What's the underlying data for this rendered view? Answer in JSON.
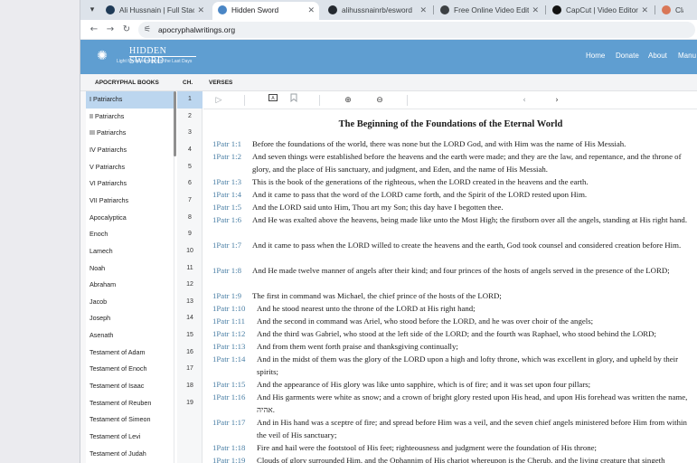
{
  "browser": {
    "tabs": [
      {
        "title": "Ali Hussnain | Full Stack",
        "active": false,
        "favicon_color": "#1f3b57"
      },
      {
        "title": "Hidden Sword",
        "active": true,
        "favicon_color": "#4a86c5"
      },
      {
        "title": "alihussnainrb/esword",
        "active": false,
        "favicon_color": "#24292f"
      },
      {
        "title": "Free Online Video Editor",
        "active": false,
        "favicon_color": "#3c4043"
      },
      {
        "title": "CapCut | Video Editor | A",
        "active": false,
        "favicon_color": "#111111"
      },
      {
        "title": "Claude",
        "active": false,
        "favicon_color": "#d97757"
      }
    ],
    "url": "apocryphalwritings.org"
  },
  "site": {
    "logo_title": "HIDDEN SWORD",
    "logo_subtitle": "Light for the remnant in the Last Days",
    "nav": [
      "Home",
      "Donate",
      "About",
      "Manu"
    ]
  },
  "columns": {
    "books": "APOCRYPHAL BOOKS",
    "chapter": "CH.",
    "verses": "VERSES"
  },
  "books": [
    "I Patriarchs",
    "II Patriarchs",
    "III Patriarchs",
    "IV Patriarchs",
    "V Patriarchs",
    "VI Patriarchs",
    "VII Patriarchs",
    "Apocalyptica",
    "Enoch",
    "Lamech",
    "Noah",
    "Abraham",
    "Jacob",
    "Joseph",
    "Asenath",
    "Testament of Adam",
    "Testament of Enoch",
    "Testament of Isaac",
    "Testament of Reuben",
    "Testament of Simeon",
    "Testament of Levi",
    "Testament of Judah"
  ],
  "selected_book": 0,
  "chapters": [
    "1",
    "2",
    "3",
    "4",
    "5",
    "6",
    "7",
    "8",
    "9",
    "10",
    "11",
    "12",
    "13",
    "14",
    "15",
    "16",
    "17",
    "18",
    "19"
  ],
  "selected_chapter": 0,
  "verse_title": "The Beginning of the Foundations of the Eternal World",
  "verses": [
    {
      "ref": "1Patr 1:1",
      "text": "Before the foundations of the world, there was none but the LORD God, and with Him was the name of His Messiah.",
      "lines": 1
    },
    {
      "ref": "1Patr 1:2",
      "text": "And seven things were established before the heavens and the earth were made; and they are the law, and repentance, and the throne of glory, and the place of His sanctuary, and judgment, and Eden, and the name of His Messiah.",
      "lines": 2
    },
    {
      "ref": "1Patr 1:3",
      "text": "This is the book of the generations of the righteous, when the LORD created in the heavens and the earth.",
      "lines": 1
    },
    {
      "ref": "1Patr 1:4",
      "text": "And it came to pass that the word of the LORD came forth, and the Spirit of the LORD rested upon Him.",
      "lines": 1
    },
    {
      "ref": "1Patr 1:5",
      "text": "And the LORD said unto Him, Thou art my Son; this day have I begotten thee.",
      "lines": 1
    },
    {
      "ref": "1Patr 1:6",
      "text": "And He was exalted above the heavens, being made like unto the Most High; the firstborn over all the angels, standing at His right hand.",
      "lines": 2
    },
    {
      "ref": "1Patr 1:7",
      "text": "And it came to pass when the LORD willed to create the heavens and the earth, God took counsel and considered creation before Him.",
      "lines": 2
    },
    {
      "ref": "1Patr 1:8",
      "text": "And He made twelve manner of angels after their kind; and four princes of the hosts of angels served in the presence of the LORD;",
      "lines": 2
    },
    {
      "ref": "1Patr 1:9",
      "text": "The first in command was Michael, the chief prince of the hosts of the LORD;",
      "lines": 1
    },
    {
      "ref": "1Patr 1:10",
      "text": "And he stood nearest unto the throne of the LORD at His right hand;",
      "lines": 1
    },
    {
      "ref": "1Patr 1:11",
      "text": "And the second in command was Ariel, who stood before the LORD, and he was over choir of the angels;",
      "lines": 1
    },
    {
      "ref": "1Patr 1:12",
      "text": "And the third was Gabriel, who stood at the left side of the LORD; and the fourth was Raphael, who stood behind the LORD;",
      "lines": 1
    },
    {
      "ref": "1Patr 1:13",
      "text": "And from them went forth praise and thanksgiving continually;",
      "lines": 1
    },
    {
      "ref": "1Patr 1:14",
      "text": "And in the midst of them was the glory of the LORD upon a high and lofty throne, which was excellent in glory, and upheld by their spirits;",
      "lines": 2
    },
    {
      "ref": "1Patr 1:15",
      "text": "And the appearance of His glory was like unto sapphire, which is of fire; and it was set upon four pillars;",
      "lines": 1
    },
    {
      "ref": "1Patr 1:16",
      "text": "And His garments were white as snow; and a crown of bright glory rested upon His head, and upon His forehead was written the name, אהיה.",
      "lines": 2
    },
    {
      "ref": "1Patr 1:17",
      "text": "And in His hand was a sceptre of fire; and spread before Him was a veil, and the seven chief angels ministered before Him from within the veil of His sanctuary;",
      "lines": 2
    },
    {
      "ref": "1Patr 1:18",
      "text": "Fire and hail were the footstool of His feet; righteousness and judgment were the foundation of His throne;",
      "lines": 1
    },
    {
      "ref": "1Patr 1:19",
      "text": "Clouds of glory surrounded Him, and the Ophannim of His chariot whereupon is the Cherub, and the living creature that singeth",
      "lines": 1
    }
  ]
}
